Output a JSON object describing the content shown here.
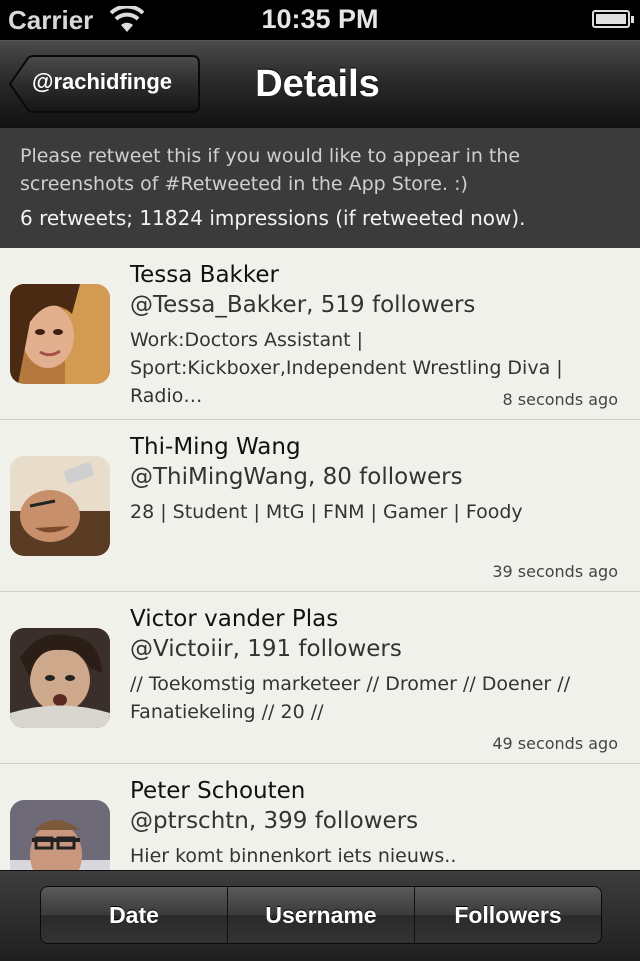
{
  "status_bar": {
    "carrier": "Carrier",
    "time": "10:35 PM"
  },
  "nav": {
    "back_label": "@rachidfinge",
    "title": "Details"
  },
  "tweet": {
    "text": "Please retweet this if you would like to appear in the screenshots of #Retweeted in the App Store. :)",
    "stats": "6 retweets; 11824 impressions (if retweeted now)."
  },
  "retweeters": [
    {
      "name": "Tessa Bakker",
      "handle": "@Tessa_Bakker, 519 followers",
      "bio": "Work:Doctors Assistant | Sport:Kickboxer,Independent Wrestling Diva | Radio…",
      "ago": "8 seconds ago"
    },
    {
      "name": "Thi-Ming Wang",
      "handle": "@ThiMingWang, 80 followers",
      "bio": "28 | Student | MtG | FNM | Gamer | Foody",
      "ago": "39 seconds ago"
    },
    {
      "name": "Victor vander Plas",
      "handle": "@Victoiir, 191 followers",
      "bio": "// Toekomstig marketeer // Dromer // Doener // Fanatiekeling // 20 //",
      "ago": "49 seconds ago"
    },
    {
      "name": "Peter Schouten",
      "handle": "@ptrschtn, 399 followers",
      "bio": "Hier komt binnenkort iets nieuws..",
      "ago": ""
    }
  ],
  "sort_segments": [
    "Date",
    "Username",
    "Followers"
  ],
  "icons": {
    "wifi": "wifi-icon",
    "battery": "battery-icon",
    "back": "back-arrow-icon"
  }
}
